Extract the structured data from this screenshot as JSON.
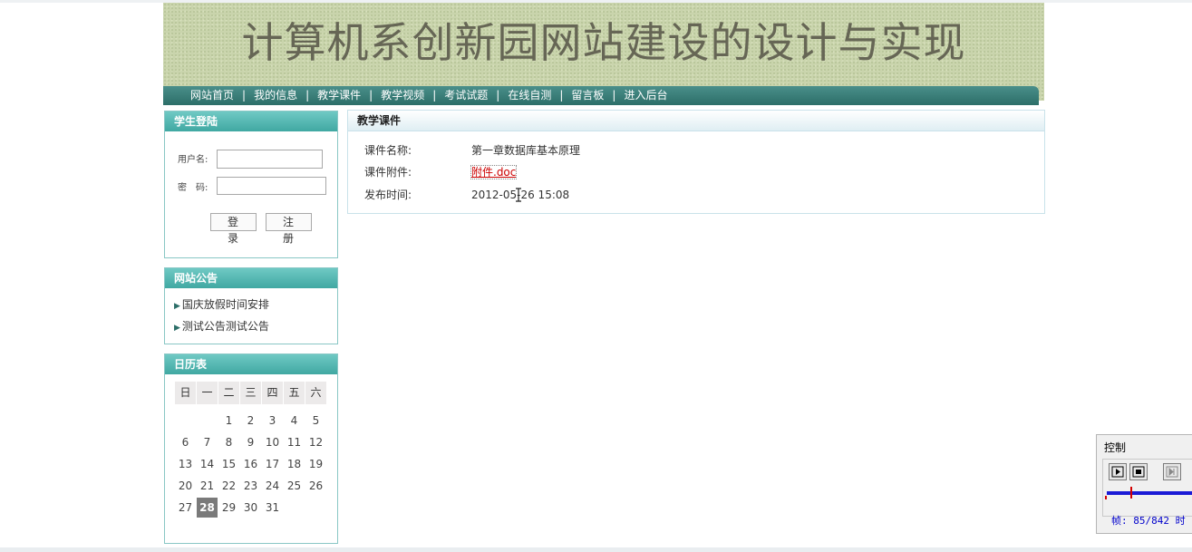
{
  "site": {
    "title": "计算机系创新园网站建设的设计与实现"
  },
  "nav": {
    "items": [
      "网站首页",
      "我的信息",
      "教学课件",
      "教学视频",
      "考试试题",
      "在线自测",
      "留言板",
      "进入后台"
    ],
    "separator": "|"
  },
  "login": {
    "title": "学生登陆",
    "username_label": "用户名:",
    "password_label": "密　码:",
    "username_value": "",
    "password_value": "",
    "login_button": "登 录",
    "register_button": "注 册"
  },
  "notices": {
    "title": "网站公告",
    "bullet": "▶",
    "items": [
      "国庆放假时间安排",
      "测试公告测试公告"
    ]
  },
  "calendar": {
    "title": "日历表",
    "weekdays": [
      "日",
      "一",
      "二",
      "三",
      "四",
      "五",
      "六"
    ],
    "weeks": [
      [
        "",
        "",
        "1",
        "2",
        "3",
        "4",
        "5"
      ],
      [
        "6",
        "7",
        "8",
        "9",
        "10",
        "11",
        "12"
      ],
      [
        "13",
        "14",
        "15",
        "16",
        "17",
        "18",
        "19"
      ],
      [
        "20",
        "21",
        "22",
        "23",
        "24",
        "25",
        "26"
      ],
      [
        "27",
        "28",
        "29",
        "30",
        "31",
        "",
        ""
      ]
    ],
    "today": "28"
  },
  "course": {
    "section_title": "教学课件",
    "rows": [
      {
        "label": "课件名称:",
        "value": "第一章数据库基本原理"
      },
      {
        "label": "课件附件:",
        "value": "附件.doc"
      },
      {
        "label": "发布时间:",
        "value": "2012-05-26 15:08"
      }
    ]
  },
  "control": {
    "title": "控制",
    "frames": "帧: 85/842 时",
    "colors": {
      "track": "#1a1ad6",
      "marker": "#d40000"
    }
  }
}
